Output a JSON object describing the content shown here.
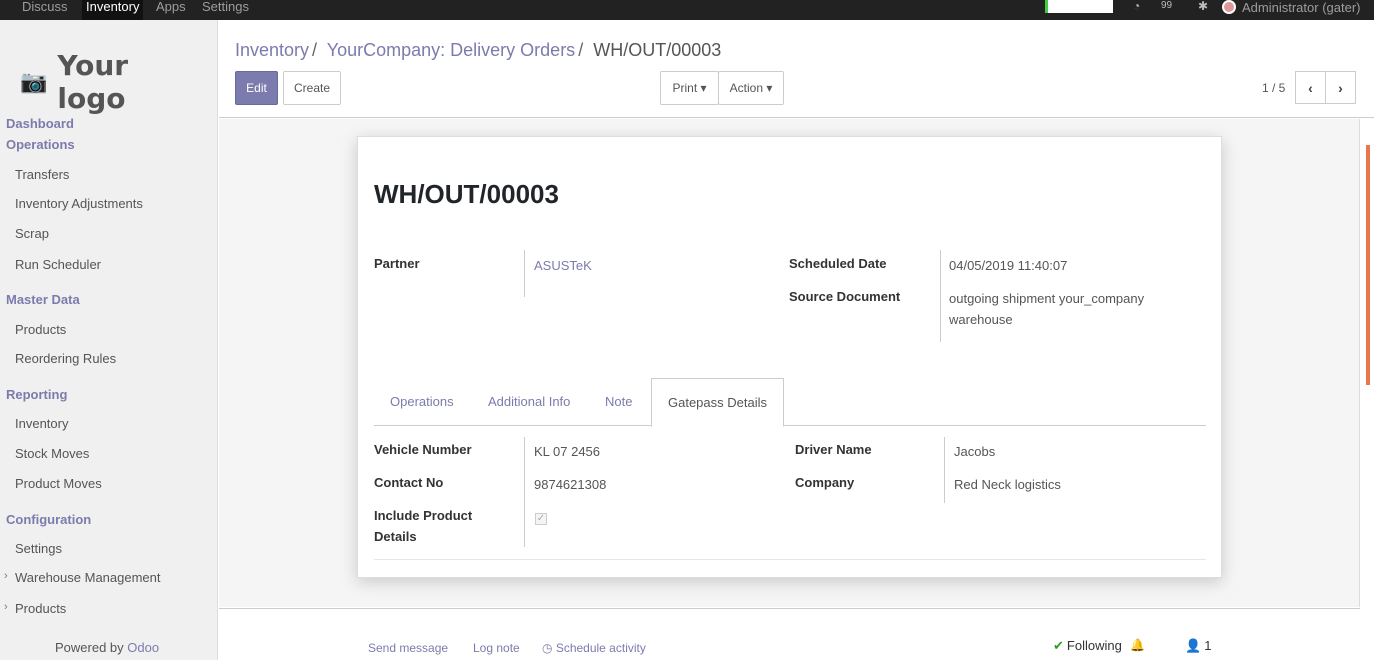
{
  "topbar": {
    "menu": [
      "Discuss",
      "Inventory",
      "Apps",
      "Settings"
    ],
    "active": "Inventory",
    "chat_count": "99",
    "user": "Administrator (gater)"
  },
  "sidebar": {
    "logo_text": "Your logo",
    "sections": [
      {
        "label": "Dashboard",
        "items": []
      },
      {
        "label": "Operations",
        "items": [
          "Transfers",
          "Inventory Adjustments",
          "Scrap",
          "Run Scheduler"
        ]
      },
      {
        "label": "Master Data",
        "items": [
          "Products",
          "Reordering Rules"
        ]
      },
      {
        "label": "Reporting",
        "items": [
          "Inventory",
          "Stock Moves",
          "Product Moves"
        ]
      },
      {
        "label": "Configuration",
        "items": [
          "Settings",
          "Warehouse Management",
          "Products"
        ]
      }
    ],
    "powered_by": "Powered by",
    "powered_brand": "Odoo"
  },
  "breadcrumb": {
    "root": "Inventory",
    "parent": "YourCompany: Delivery Orders",
    "current": "WH/OUT/00003",
    "sep": "/"
  },
  "buttons": {
    "edit": "Edit",
    "create": "Create",
    "print": "Print ▾",
    "action": "Action ▾"
  },
  "pager": {
    "value": "1 / 5"
  },
  "form": {
    "title": "WH/OUT/00003",
    "partner_label": "Partner",
    "partner_value": "ASUSTeK",
    "scheduled_date_label": "Scheduled Date",
    "scheduled_date_value": "04/05/2019 11:40:07",
    "source_document_label": "Source Document",
    "source_document_line1": "outgoing shipment your_company",
    "source_document_line2": "warehouse",
    "tabs": [
      "Operations",
      "Additional Info",
      "Note",
      "Gatepass Details"
    ],
    "active_tab": "Gatepass Details",
    "vehicle_number_label": "Vehicle Number",
    "vehicle_number_value": "KL 07 2456",
    "contact_no_label": "Contact No",
    "contact_no_value": "9874621308",
    "include_product_label_line1": "Include Product",
    "include_product_label_line2": "Details",
    "include_product_checked": true,
    "driver_name_label": "Driver Name",
    "driver_name_value": "Jacobs",
    "company_label": "Company",
    "company_value": "Red Neck logistics"
  },
  "chatter": {
    "send_message": "Send message",
    "log_note": "Log note",
    "schedule_activity": "Schedule activity",
    "following": "Following",
    "followers_count": "1"
  },
  "colors": {
    "accent": "#7c7bad",
    "topbar": "#222222",
    "sidebar": "#f0f0f0"
  }
}
